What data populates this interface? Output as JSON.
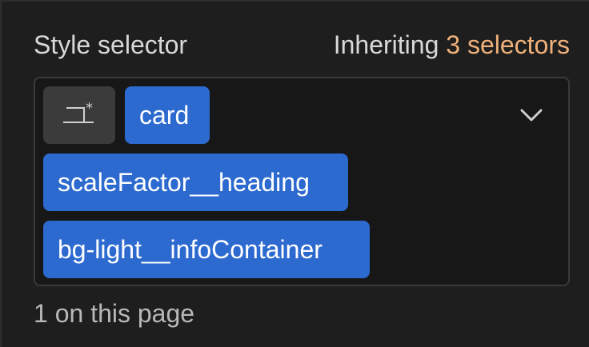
{
  "header": {
    "title": "Style selector",
    "inheriting_prefix": "Inheriting",
    "inheriting_count": "3 selectors"
  },
  "selectors": {
    "icon": "tag-selector-icon",
    "chips": [
      {
        "label": "card"
      },
      {
        "label": "scaleFactor__heading"
      },
      {
        "label": "bg-light__infoContainer"
      }
    ],
    "dropdown_icon": "chevron-down-icon"
  },
  "footer": {
    "usage_text": "1 on this page"
  },
  "colors": {
    "background": "#1e1e1e",
    "chip_blue": "#2d6ad0",
    "accent_orange": "#f0b17a"
  }
}
